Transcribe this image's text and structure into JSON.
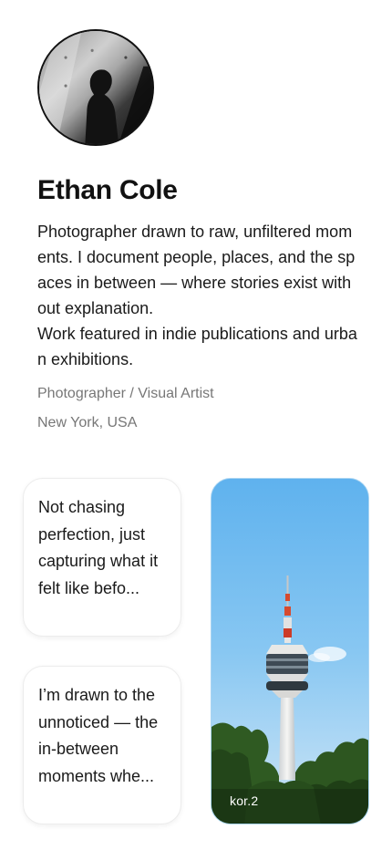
{
  "profile": {
    "name": "Ethan Cole",
    "bio_lines": [
      "Photographer drawn to raw, unfiltered moments. I document people, places, and the spaces in between — where stories exist without explanation.",
      "Work featured in indie publications and urban exhibitions."
    ],
    "role": "Photographer / Visual Artist",
    "location": "New York, USA",
    "avatar_icon": "portrait-photo"
  },
  "notes": [
    {
      "text": "Not chasing perfection, just capturing what it felt like befo..."
    },
    {
      "text": "I’m drawn to the unnoticed — the in-between moments whe..."
    }
  ],
  "photo": {
    "caption": "kor.2",
    "icon": "tower-photo"
  },
  "colors": {
    "text_primary": "#111111",
    "text_secondary": "#777777",
    "sky": "#6cb9ef",
    "card_border": "#ececec"
  }
}
